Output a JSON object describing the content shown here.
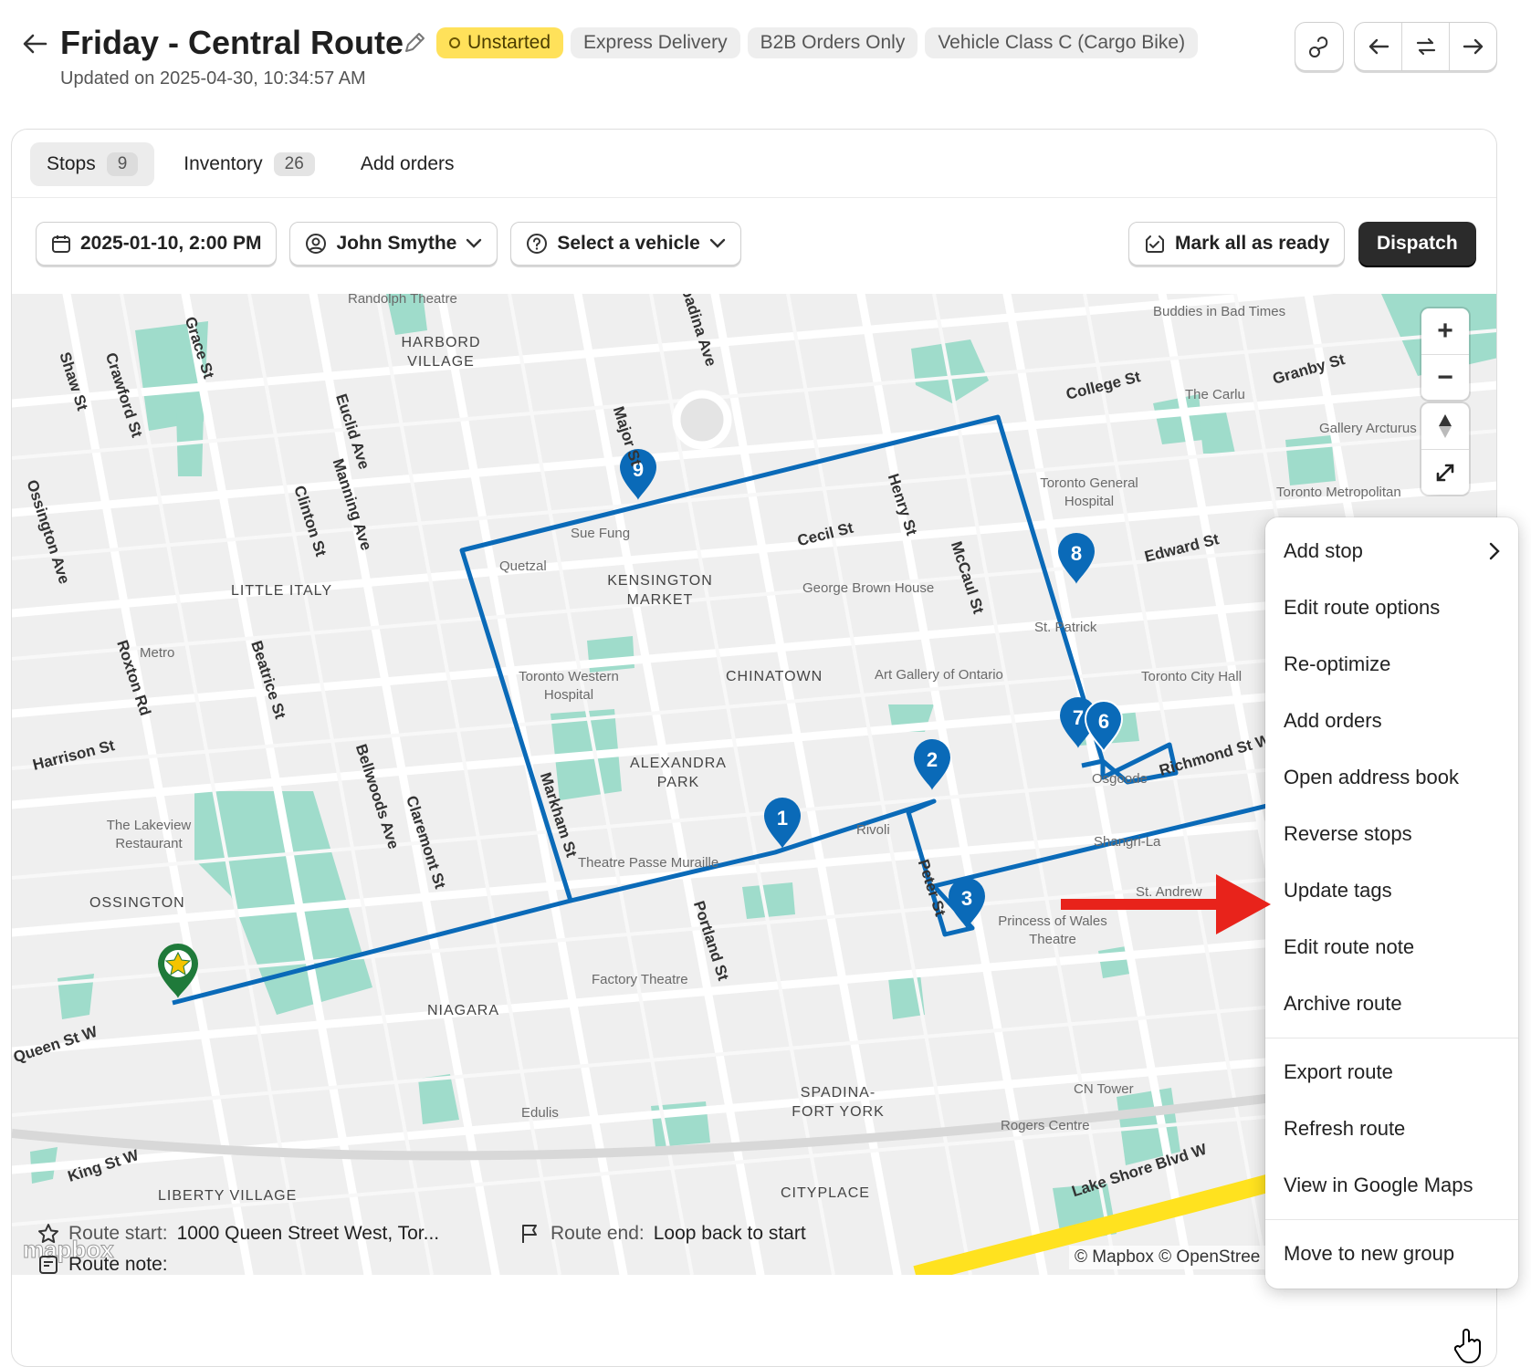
{
  "header": {
    "title": "Friday - Central Route",
    "status": "Unstarted",
    "tags": [
      "Express Delivery",
      "B2B Orders Only",
      "Vehicle Class C (Cargo Bike)"
    ],
    "updated": "Updated on 2025-04-30, 10:34:57 AM"
  },
  "tabs": [
    {
      "label": "Stops",
      "count": "9"
    },
    {
      "label": "Inventory",
      "count": "26"
    },
    {
      "label": "Add orders",
      "count": null
    }
  ],
  "toolbar": {
    "date": "2025-01-10, 2:00 PM",
    "driver": "John Smythe",
    "vehicle": "Select a vehicle",
    "mark_ready": "Mark all as ready",
    "dispatch": "Dispatch"
  },
  "map": {
    "stops": [
      "1",
      "2",
      "3",
      "6",
      "7",
      "8",
      "9"
    ],
    "neighbourhoods": [
      "HARBORD VILLAGE",
      "LITTLE ITALY",
      "KENSINGTON MARKET",
      "CHINATOWN",
      "ALEXANDRA PARK",
      "OSSINGTON",
      "NIAGARA",
      "SPADINA-FORT YORK",
      "CITYPLACE",
      "LIBERTY VILLAGE"
    ],
    "streets": [
      "College St",
      "Granby St",
      "Edward St",
      "Cecil St",
      "Henry St",
      "McCaul St",
      "Harrison St",
      "King St W",
      "Lake Shore Blvd W",
      "Richmond St W",
      "Major St",
      "Grace St",
      "Shaw St",
      "Crawford St",
      "Euclid Ave",
      "Manning Ave",
      "Clinton St",
      "Roxton Rd",
      "Beatrice St",
      "Bellwoods Ave",
      "Claremont St",
      "Portland St",
      "Peter St",
      "Markham St",
      "Ossington Ave",
      "Queen St W",
      "Spadina Ave"
    ],
    "pois": [
      "Randolph Theatre",
      "Buddies in Bad Times",
      "The Carlu",
      "Gallery Arcturus",
      "Toronto Metropolitan",
      "Toronto General Hospital",
      "Sue Fung",
      "Quetzal",
      "George Brown House",
      "St. Patrick",
      "Toronto Western Hospital",
      "Art Gallery of Ontario",
      "Toronto City Hall",
      "Metro",
      "Osgoode",
      "Rivoli",
      "Theatre Passe Muraille",
      "Shangri-La",
      "The Lakeview Restaurant",
      "St. Andrew",
      "Princess of Wales Theatre",
      "Factory Theatre",
      "CN Tower",
      "Rogers Centre",
      "Edulis"
    ],
    "attribution": "© Mapbox © OpenStree",
    "logo": "mapbox"
  },
  "footer": {
    "start_label": "Route start:",
    "start_value": "1000 Queen Street West, Tor...",
    "end_label": "Route end:",
    "end_value": "Loop back to start",
    "note_label": "Route note:"
  },
  "menu": {
    "items": [
      "Add stop",
      "Edit route options",
      "Re-optimize",
      "Add orders",
      "Open address book",
      "Reverse stops",
      "Update tags",
      "Edit route note",
      "Archive route"
    ],
    "items2": [
      "Export route",
      "Refresh route",
      "View in Google Maps"
    ],
    "items3": [
      "Move to new group"
    ]
  },
  "colors": {
    "route": "#0a6ab8",
    "status": "#ffe15a",
    "arrow": "#e8231b",
    "park": "#9fdccb"
  }
}
